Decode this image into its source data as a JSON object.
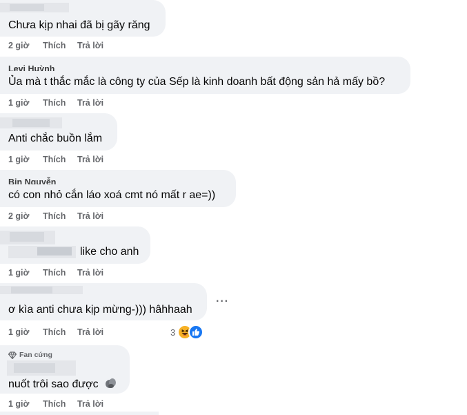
{
  "comments": [
    {
      "name": "",
      "text": "Chưa kịp nhai đã bị gãy răng",
      "time": "2 giờ",
      "like": "Thích",
      "reply": "Trả lời"
    },
    {
      "name": "Levi Huỳnh",
      "text": "Ủa mà t thắc mắc là công ty của Sếp là kinh doanh bất động sản hả mấy bồ?",
      "time": "1 giờ",
      "like": "Thích",
      "reply": "Trả lời"
    },
    {
      "name": "",
      "text": "Anti chắc buồn lắm",
      "time": "1 giờ",
      "like": "Thích",
      "reply": "Trả lời"
    },
    {
      "name": "Bin Nguyễn",
      "text": "có con nhỏ cắn láo xoá cmt nó mất r ae=))",
      "time": "2 giờ",
      "like": "Thích",
      "reply": "Trả lời"
    },
    {
      "name": "",
      "text": "like cho anh",
      "time": "1 giờ",
      "like": "Thích",
      "reply": "Trả lời"
    },
    {
      "name": "",
      "text": "ơ kìa anti chưa kịp mừng-))) hâhhaah",
      "time": "1 giờ",
      "like": "Thích",
      "reply": "Trả lời",
      "reaction_count": "3",
      "more": "···"
    },
    {
      "badge": "Fan cứng",
      "name": "",
      "text": "nuốt trôi sao được",
      "time": "1 giờ",
      "like": "Thích",
      "reply": "Trả lời"
    }
  ],
  "icons": {
    "more": "more-options-icon",
    "haha": "haha-reaction-icon",
    "like": "like-reaction-icon",
    "badge": "diamond-icon",
    "emoji": "sad-face-emoji-icon"
  },
  "colors": {
    "bubble": "#f0f2f5",
    "text": "#050505",
    "secondary": "#65676b",
    "like_blue": "#1877f2",
    "haha_yellow": "#f7b125"
  }
}
